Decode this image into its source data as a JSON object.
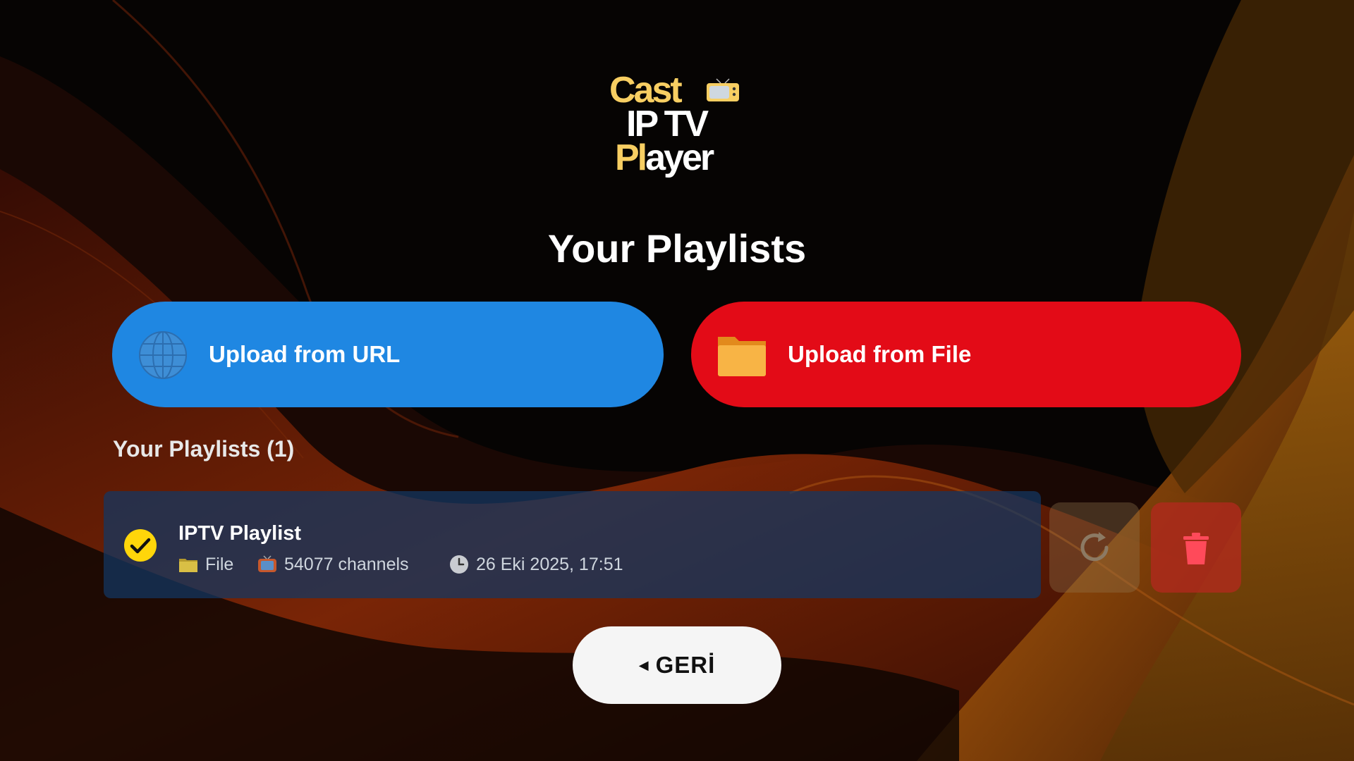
{
  "logo": {
    "line1": "Cast",
    "line2": "IP TV",
    "line3_accent": "Pl",
    "line3_rest": "ayer"
  },
  "page_title": "Your Playlists",
  "upload_url": {
    "label": "Upload from URL",
    "icon": "globe-icon"
  },
  "upload_file": {
    "label": "Upload from File",
    "icon": "folder-icon"
  },
  "section_title": "Your Playlists (1)",
  "playlists": [
    {
      "name": "IPTV Playlist",
      "source": "File",
      "channels": "54077 channels",
      "date": "26 Eki 2025, 17:51",
      "selected": true
    }
  ],
  "actions": {
    "refresh_icon": "refresh-icon",
    "delete_icon": "trash-icon"
  },
  "back": {
    "arrow": "◀",
    "label": "GERİ"
  },
  "colors": {
    "url_button": "#1f87e2",
    "file_button": "#e30b17",
    "logo_accent": "#f7ce62",
    "card": "#123864",
    "check": "#ffd60a"
  }
}
